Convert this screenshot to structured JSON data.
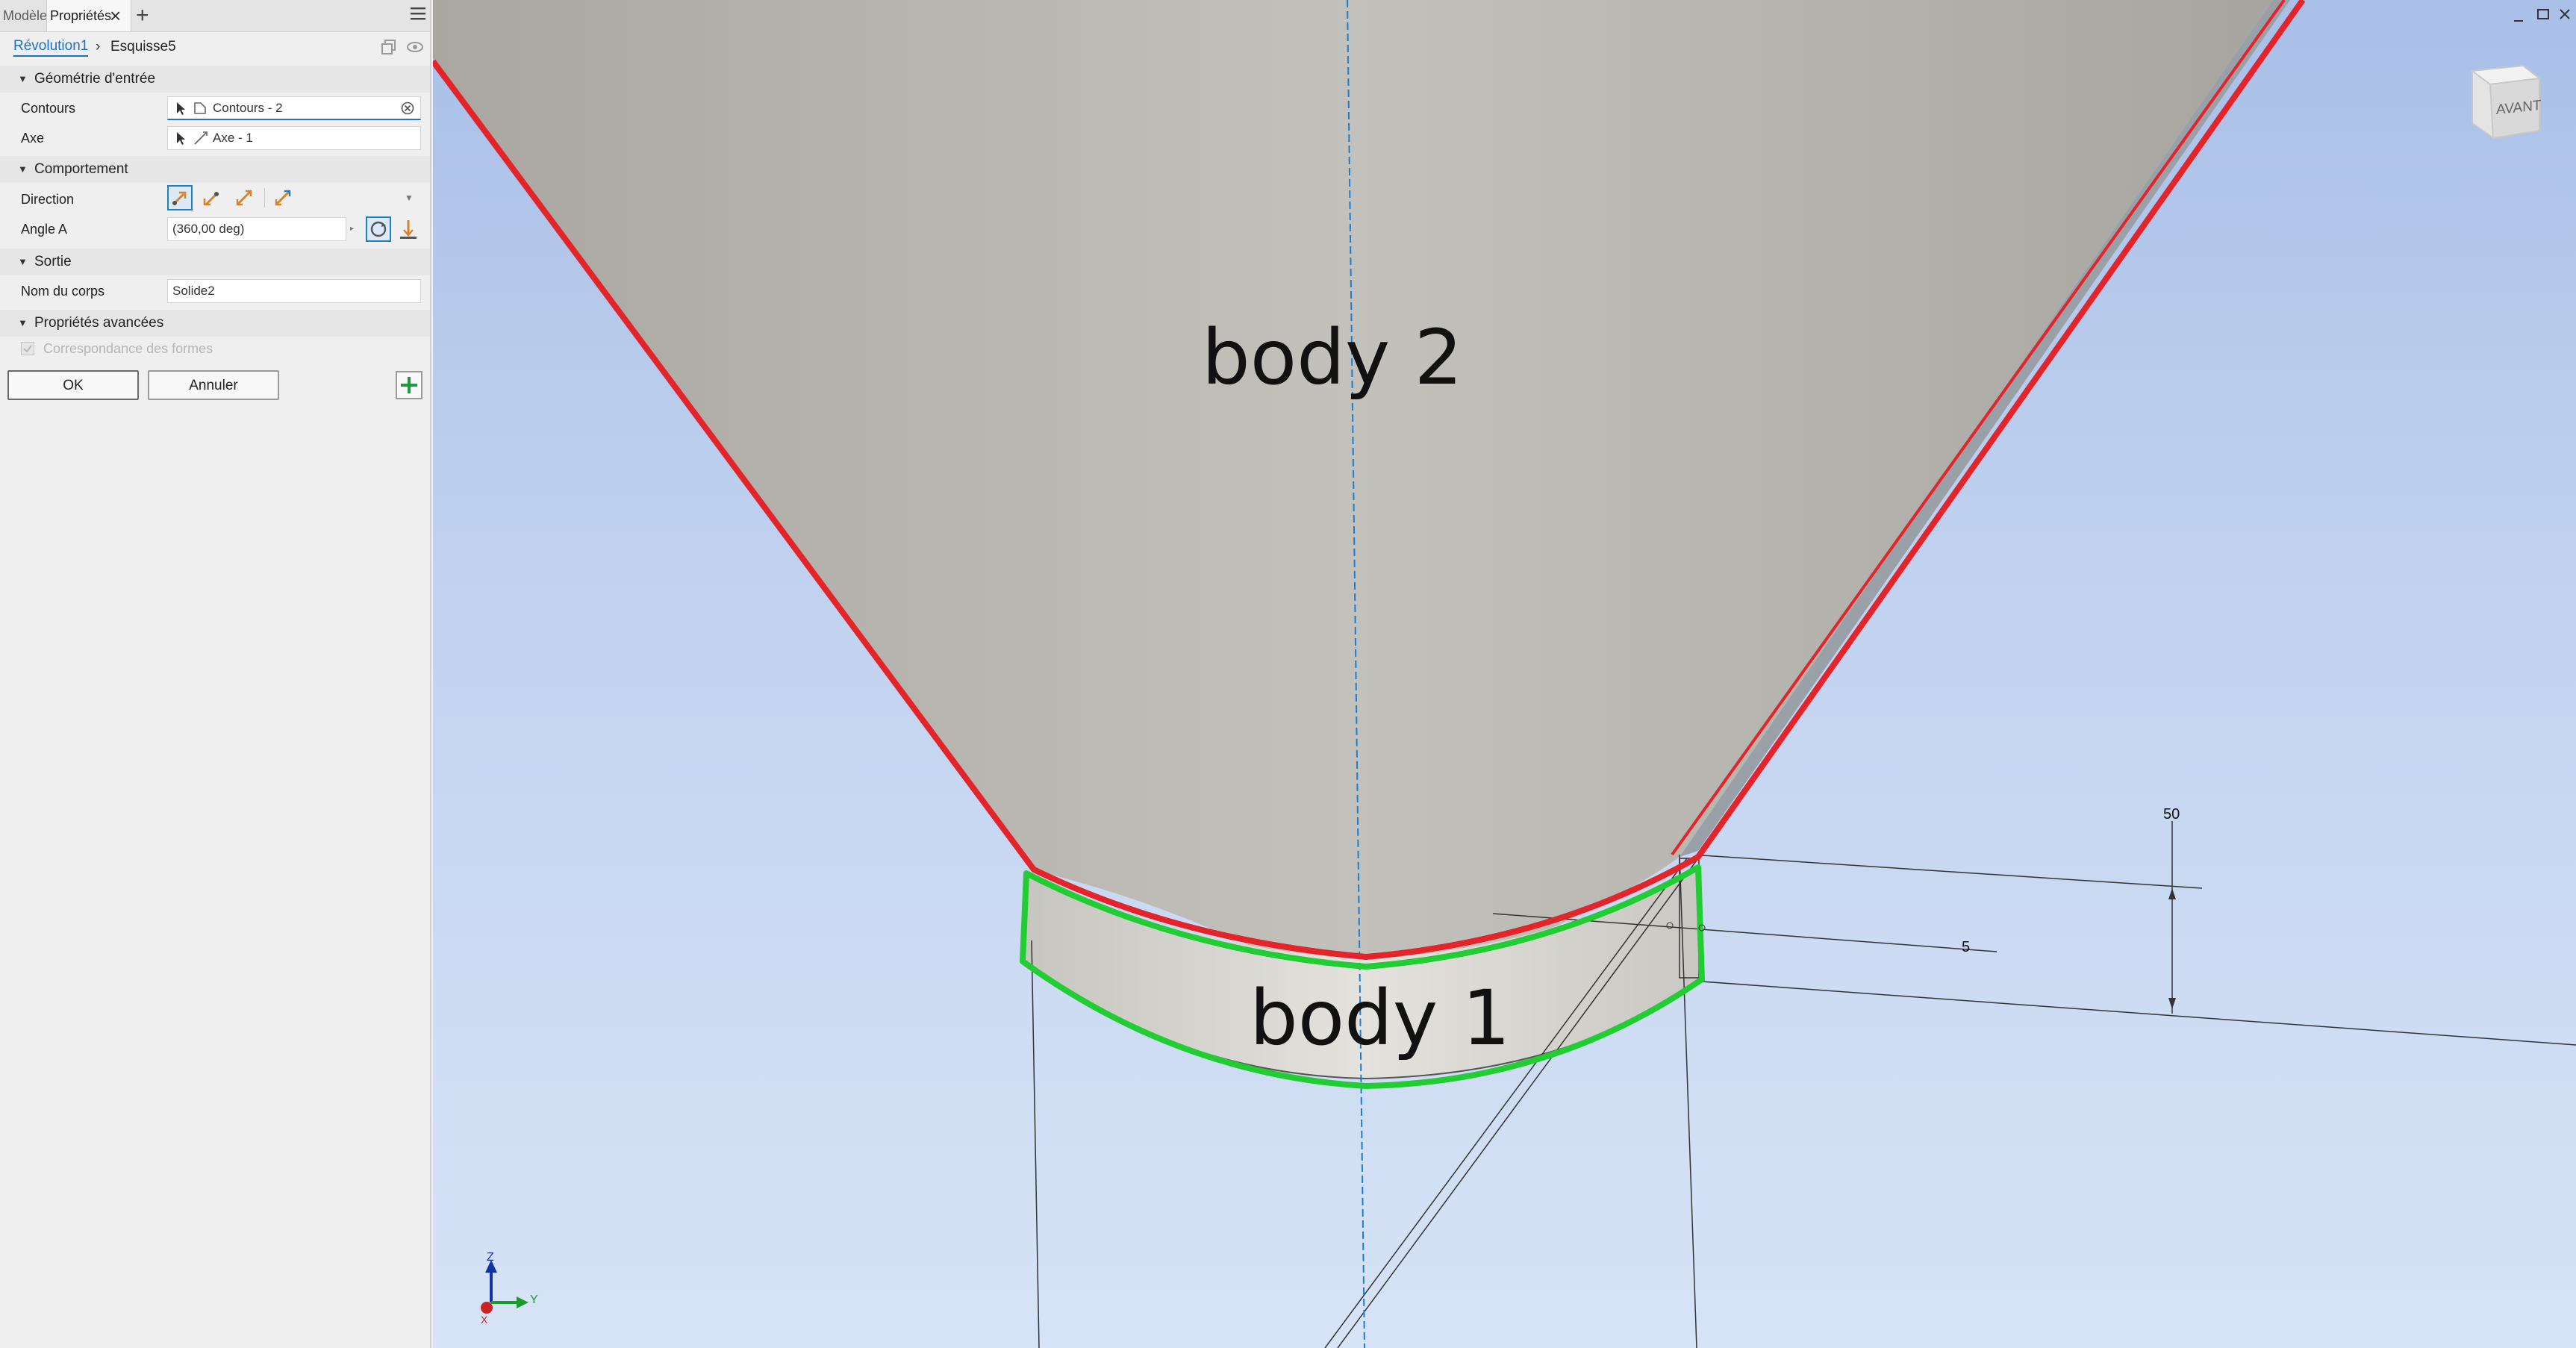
{
  "tabs": [
    {
      "label": "Modèle",
      "active": false
    },
    {
      "label": "Propriétés",
      "active": true
    }
  ],
  "breadcrumb": {
    "feature": "Révolution1",
    "sketch": "Esquisse5"
  },
  "sections": {
    "input_geometry": "Géométrie d'entrée",
    "behavior": "Comportement",
    "output": "Sortie",
    "advanced": "Propriétés avancées"
  },
  "fields": {
    "contours_label": "Contours",
    "contours_value": "Contours - 2",
    "axis_label": "Axe",
    "axis_value": "Axe - 1",
    "direction_label": "Direction",
    "angle_label": "Angle A",
    "angle_value": "(360,00 deg)",
    "body_name_label": "Nom du corps",
    "body_name_value": "Solide2",
    "shape_match_label": "Correspondance des formes"
  },
  "buttons": {
    "ok": "OK",
    "cancel": "Annuler"
  },
  "viewport": {
    "body2_label": "body 2",
    "body1_label": "body 1",
    "dim_50": "50",
    "dim_5": "5",
    "viewcube_face": "AVANT",
    "triad_z": "Z",
    "triad_y": "Y",
    "triad_x": "X"
  },
  "colors": {
    "highlight_red": "#e3252b",
    "highlight_green": "#22cc33",
    "accent_blue": "#1a7fd0",
    "add_green": "#1f9b3a"
  }
}
